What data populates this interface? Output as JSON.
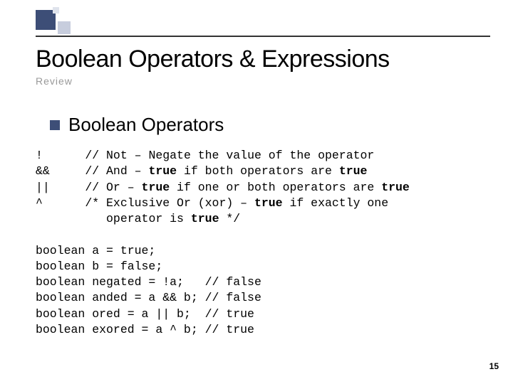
{
  "header": {
    "title": "Boolean Operators & Expressions",
    "subtitle": "Review"
  },
  "section": {
    "heading": "Boolean Operators"
  },
  "ops": {
    "o1_sym": "!",
    "o1_pre": "// Not – Negate the value of the operator",
    "o2_sym": "&&",
    "o2_pre": "// And – ",
    "o2_b1": "true",
    "o2_mid": " if both operators are ",
    "o2_b2": "true",
    "o3_sym": "||",
    "o3_pre": "// Or – ",
    "o3_b1": "true",
    "o3_mid": " if one or both operators are ",
    "o3_b2": "true",
    "o4_sym": "^",
    "o4_pre": "/* Exclusive Or (xor) – ",
    "o4_b1": "true",
    "o4_mid": " if exactly one",
    "o4_l2a": "operator is ",
    "o4_b2": "true",
    "o4_l2b": " */"
  },
  "code": {
    "l1": "boolean a = true;",
    "l2": "boolean b = false;",
    "l3": "boolean negated = !a;   // false",
    "l4": "boolean anded = a && b; // false",
    "l5": "boolean ored = a || b;  // true",
    "l6": "boolean exored = a ^ b; // true"
  },
  "page": {
    "number": "15"
  }
}
